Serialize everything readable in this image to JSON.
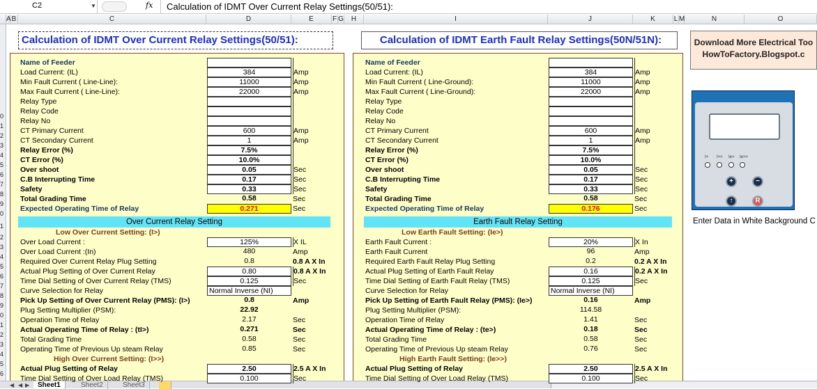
{
  "name_box": "C2",
  "formula": "Calculation of IDMT Over Current Relay Settings(50/51):",
  "columns": [
    "A",
    "B",
    "C",
    "D",
    "E",
    "F",
    "G",
    "H",
    "I",
    "J",
    "K",
    "L",
    "M",
    "N",
    "O"
  ],
  "row_numbers": [
    "",
    "",
    "",
    "",
    "",
    "",
    "",
    "",
    "",
    "",
    "0",
    "1",
    "2",
    "3",
    "4",
    "5",
    "6",
    "7",
    "8",
    "9",
    "0",
    "1",
    "2",
    "3",
    "4",
    "5",
    "6",
    "7",
    "8",
    "9",
    "0",
    "1",
    "2",
    "3",
    "4",
    "5"
  ],
  "oc": {
    "title": "Calculation of IDMT Over Current Relay Settings(50/51):",
    "params": [
      {
        "label": "Name of Feeder",
        "value": "",
        "unit": "",
        "style": "bb",
        "box": true
      },
      {
        "label": "Load Current: (IL)",
        "value": "384",
        "unit": "Amp",
        "style": "",
        "box": true
      },
      {
        "label": "Min Fault Current ( Line-Line):",
        "value": "11000",
        "unit": "Amp",
        "style": "",
        "box": true
      },
      {
        "label": "Max Fault Current ( Line-Line):",
        "value": "22000",
        "unit": "Amp",
        "style": "",
        "box": true
      },
      {
        "label": "Relay Type",
        "value": "",
        "unit": "",
        "style": "",
        "box": true
      },
      {
        "label": "Relay Code",
        "value": "",
        "unit": "",
        "style": "",
        "box": true
      },
      {
        "label": "Relay No",
        "value": "",
        "unit": "",
        "style": "",
        "box": true
      },
      {
        "label": "CT Primary Current",
        "value": "600",
        "unit": "Amp",
        "style": "",
        "box": true
      },
      {
        "label": "CT Secondary Current",
        "value": "1",
        "unit": "Amp",
        "style": "",
        "box": true
      },
      {
        "label": "Relay Error (%)",
        "value": "7.5%",
        "unit": "",
        "style": "b",
        "box": true
      },
      {
        "label": "CT Error (%)",
        "value": "10.0%",
        "unit": "",
        "style": "b",
        "box": true
      },
      {
        "label": "Over shoot",
        "value": "0.05",
        "unit": "Sec",
        "style": "b",
        "box": true
      },
      {
        "label": "C.B Interrupting Time",
        "value": "0.17",
        "unit": "Sec",
        "style": "b",
        "box": true
      },
      {
        "label": "Safety",
        "value": "0.33",
        "unit": "Sec",
        "style": "b",
        "box": true
      },
      {
        "label": "Total Grading Time",
        "value": "0.58",
        "unit": "Sec",
        "style": "b",
        "box": false
      },
      {
        "label": "Expected Operating Time of Relay",
        "value": "0.271",
        "unit": "Sec",
        "style": "bb",
        "box": "red"
      }
    ],
    "band": "Over Current Relay Setting",
    "low_title": "Low Over Current Setting: (I>)",
    "low_rows": [
      {
        "label": "Over Load Current :",
        "value": "125%",
        "unit": "X IL",
        "style": "",
        "box": true,
        "ub": false
      },
      {
        "label": "Over Load Current :(In)",
        "value": "480",
        "unit": "Amp",
        "style": "",
        "box": false,
        "ub": false
      },
      {
        "label": "Required Over Current Relay Plug Setting",
        "value": "0.8",
        "unit": "0.8 A X In",
        "style": "",
        "box": false,
        "ub": true
      },
      {
        "label": "Actual Plug Setting of Over Current Relay",
        "value": "0.80",
        "unit": "0.8 A X In",
        "style": "",
        "box": true,
        "ub": true
      },
      {
        "label": "Time Dial Setting of Over Current Relay (TMS)",
        "value": "0.125",
        "unit": "Sec",
        "style": "",
        "box": true,
        "ub": false
      },
      {
        "label": "Curve Selection for Relay",
        "value": "Normal Inverse (NI)",
        "unit": "",
        "style": "",
        "box": "left",
        "ub": false
      },
      {
        "label": "Pick Up Setting of Over Current Relay (PMS): (I>)",
        "value": "0.8",
        "unit": "Amp",
        "style": "b",
        "box": false,
        "ub": true
      },
      {
        "label": "Plug Setting Multiplier (PSM):",
        "value": "22.92",
        "unit": "",
        "style": "",
        "box": false,
        "ub": false,
        "vb": true
      },
      {
        "label": "Operation Time of Relay",
        "value": "2.17",
        "unit": "Sec",
        "style": "",
        "box": false,
        "ub": false
      },
      {
        "label": "Actual Operating Time of Relay : (tI>)",
        "value": "0.271",
        "unit": "Sec",
        "style": "b",
        "box": false,
        "ub": true
      },
      {
        "label": "Total Grading Time",
        "value": "0.58",
        "unit": "Sec",
        "style": "",
        "box": false,
        "ub": false
      },
      {
        "label": "Operating Time of Previous Up steam Relay",
        "value": "0.85",
        "unit": "Sec",
        "style": "",
        "box": false,
        "ub": false
      }
    ],
    "high_title": "High Over Current Setting: (I>>)",
    "high_rows": [
      {
        "label": "Actual Plug Setting of Relay",
        "value": "2.50",
        "unit": "2.5 A X In",
        "style": "b",
        "box": true,
        "ub": true
      },
      {
        "label": "Time Dial Setting of Over Load Relay (TMS)",
        "value": "0.100",
        "unit": "Sec",
        "style": "",
        "box": true,
        "ub": false
      }
    ]
  },
  "ef": {
    "title": "Calculation of IDMT Earth Fault Relay Settings(50N/51N):",
    "params": [
      {
        "label": "Name of Feeder",
        "value": "",
        "unit": "",
        "style": "bb",
        "box": true
      },
      {
        "label": "Load Current: (IL)",
        "value": "384",
        "unit": "Amp",
        "style": "",
        "box": true
      },
      {
        "label": "Min Fault Current ( Line-Ground):",
        "value": "11000",
        "unit": "Amp",
        "style": "",
        "box": true
      },
      {
        "label": "Max Fault Current ( Line-Ground):",
        "value": "22000",
        "unit": "Amp",
        "style": "",
        "box": true
      },
      {
        "label": "Relay Type",
        "value": "",
        "unit": "",
        "style": "",
        "box": true
      },
      {
        "label": "Relay Code",
        "value": "",
        "unit": "",
        "style": "",
        "box": true
      },
      {
        "label": "Relay No",
        "value": "",
        "unit": "",
        "style": "",
        "box": true
      },
      {
        "label": "CT Primary Current",
        "value": "600",
        "unit": "Amp",
        "style": "",
        "box": true
      },
      {
        "label": "CT Secondary Current",
        "value": "1",
        "unit": "Amp",
        "style": "",
        "box": true
      },
      {
        "label": "Relay Error (%)",
        "value": "7.5%",
        "unit": "",
        "style": "b",
        "box": true
      },
      {
        "label": "CT Error (%)",
        "value": "10.0%",
        "unit": "",
        "style": "b",
        "box": true
      },
      {
        "label": "Over shoot",
        "value": "0.05",
        "unit": "Sec",
        "style": "b",
        "box": true
      },
      {
        "label": "C.B Interrupting Time",
        "value": "0.17",
        "unit": "Sec",
        "style": "b",
        "box": true
      },
      {
        "label": "Safety",
        "value": "0.33",
        "unit": "Sec",
        "style": "b",
        "box": true
      },
      {
        "label": "Total Grading Time",
        "value": "0.58",
        "unit": "Sec",
        "style": "b",
        "box": false
      },
      {
        "label": "Expected Operating Time of Relay",
        "value": "0.176",
        "unit": "Sec",
        "style": "bb",
        "box": "red"
      }
    ],
    "band": "Earth Fault Relay Setting",
    "low_title": "Low Earth Fault Setting: (Ie>)",
    "low_rows": [
      {
        "label": "Earth Fault Current :",
        "value": "20%",
        "unit": "X In",
        "style": "",
        "box": true,
        "ub": false
      },
      {
        "label": "Earth Fault Current",
        "value": "96",
        "unit": "Amp",
        "style": "",
        "box": false,
        "ub": false
      },
      {
        "label": "Required Earth Fault Relay Plug Setting",
        "value": "0.2",
        "unit": "0.2 A X In",
        "style": "",
        "box": false,
        "ub": true
      },
      {
        "label": "Actual Plug Setting of Earth Fault Relay",
        "value": "0.16",
        "unit": "0.2 A X In",
        "style": "",
        "box": true,
        "ub": true
      },
      {
        "label": "Time Dial Setting of Earth Fault Relay (TMS)",
        "value": "0.125",
        "unit": "Sec",
        "style": "",
        "box": true,
        "ub": false
      },
      {
        "label": "Curve Selection for Relay",
        "value": "Normal Inverse (NI)",
        "unit": "",
        "style": "",
        "box": "left",
        "ub": false
      },
      {
        "label": "Pick Up Setting of Earth Fault Relay (PMS): (Ie>)",
        "value": "0.16",
        "unit": "Amp",
        "style": "b",
        "box": false,
        "ub": true
      },
      {
        "label": "Plug Setting Multiplier (PSM):",
        "value": "114.58",
        "unit": "",
        "style": "",
        "box": false,
        "ub": false
      },
      {
        "label": "Operation Time of Relay",
        "value": "1.41",
        "unit": "Sec",
        "style": "",
        "box": false,
        "ub": false
      },
      {
        "label": "Actual Operating Time of Relay : (te>)",
        "value": "0.18",
        "unit": "Sec",
        "style": "b",
        "box": false,
        "ub": true
      },
      {
        "label": "Total Grading Time",
        "value": "0.58",
        "unit": "Sec",
        "style": "",
        "box": false,
        "ub": false
      },
      {
        "label": "Operating Time of Previous Up steam Relay",
        "value": "0.76",
        "unit": "Sec",
        "style": "",
        "box": false,
        "ub": false
      }
    ],
    "high_title": "High Earth Fault Setting: (Ie>>)",
    "high_rows": [
      {
        "label": "Actual Plug Setting of Relay",
        "value": "2.50",
        "unit": "2.5 A X In",
        "style": "b",
        "box": true,
        "ub": true
      },
      {
        "label": "Time Dial Setting of Over Load Relay (TMS)",
        "value": "0.100",
        "unit": "Sec",
        "style": "",
        "box": true,
        "ub": false
      }
    ]
  },
  "side": {
    "download_line1": "Download More Electrical Too",
    "download_line2": "HowToFactory.Blogspot.c",
    "relay_leds": [
      "I>",
      "I>>",
      "Ie>",
      "Ie>>"
    ],
    "enter_note": "Enter Data in White Background C"
  },
  "sheets": [
    "Sheet1",
    "Sheet2",
    "Sheet3"
  ]
}
